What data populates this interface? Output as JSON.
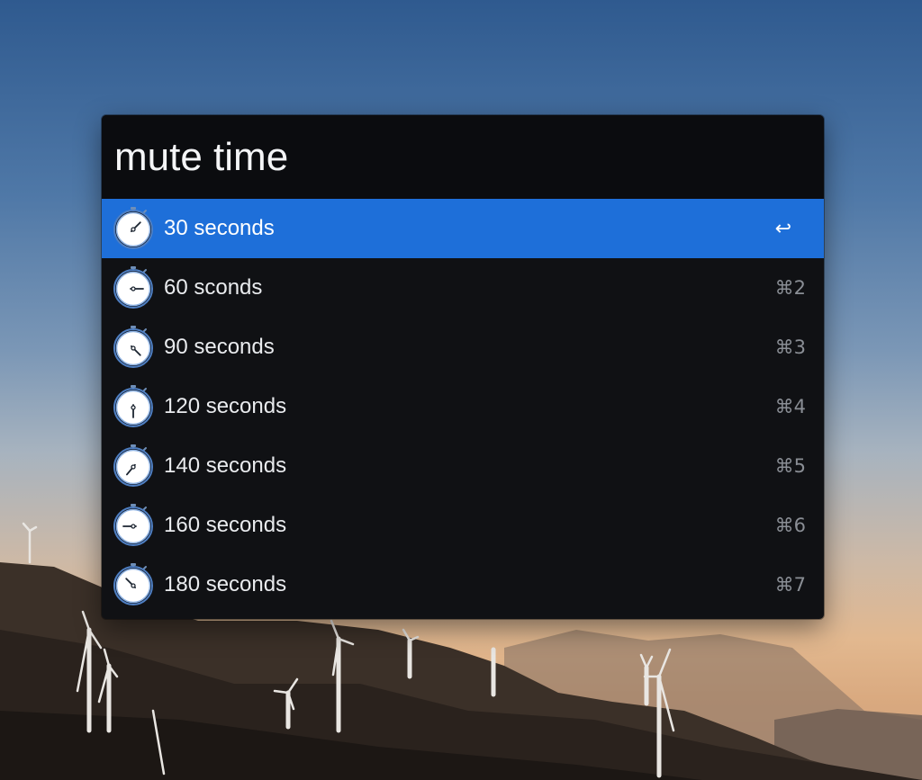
{
  "search": {
    "query": "mute time"
  },
  "results": [
    {
      "title": "30 seconds",
      "shortcut": "↩",
      "hand_angle": 45,
      "selected": true
    },
    {
      "title": "60 sconds",
      "shortcut": "⌘2",
      "hand_angle": 90,
      "selected": false
    },
    {
      "title": "90 seconds",
      "shortcut": "⌘3",
      "hand_angle": 135,
      "selected": false
    },
    {
      "title": "120 seconds",
      "shortcut": "⌘4",
      "hand_angle": 180,
      "selected": false
    },
    {
      "title": "140 seconds",
      "shortcut": "⌘5",
      "hand_angle": 220,
      "selected": false
    },
    {
      "title": "160 seconds",
      "shortcut": "⌘6",
      "hand_angle": 270,
      "selected": false
    },
    {
      "title": "180 seconds",
      "shortcut": "⌘7",
      "hand_angle": 315,
      "selected": false
    }
  ],
  "colors": {
    "accent": "#1e6fd9",
    "panel": "#101114",
    "text": "#e9ebee",
    "shortcut": "#8a8e95"
  },
  "icons": {
    "result": "stopwatch-icon"
  }
}
